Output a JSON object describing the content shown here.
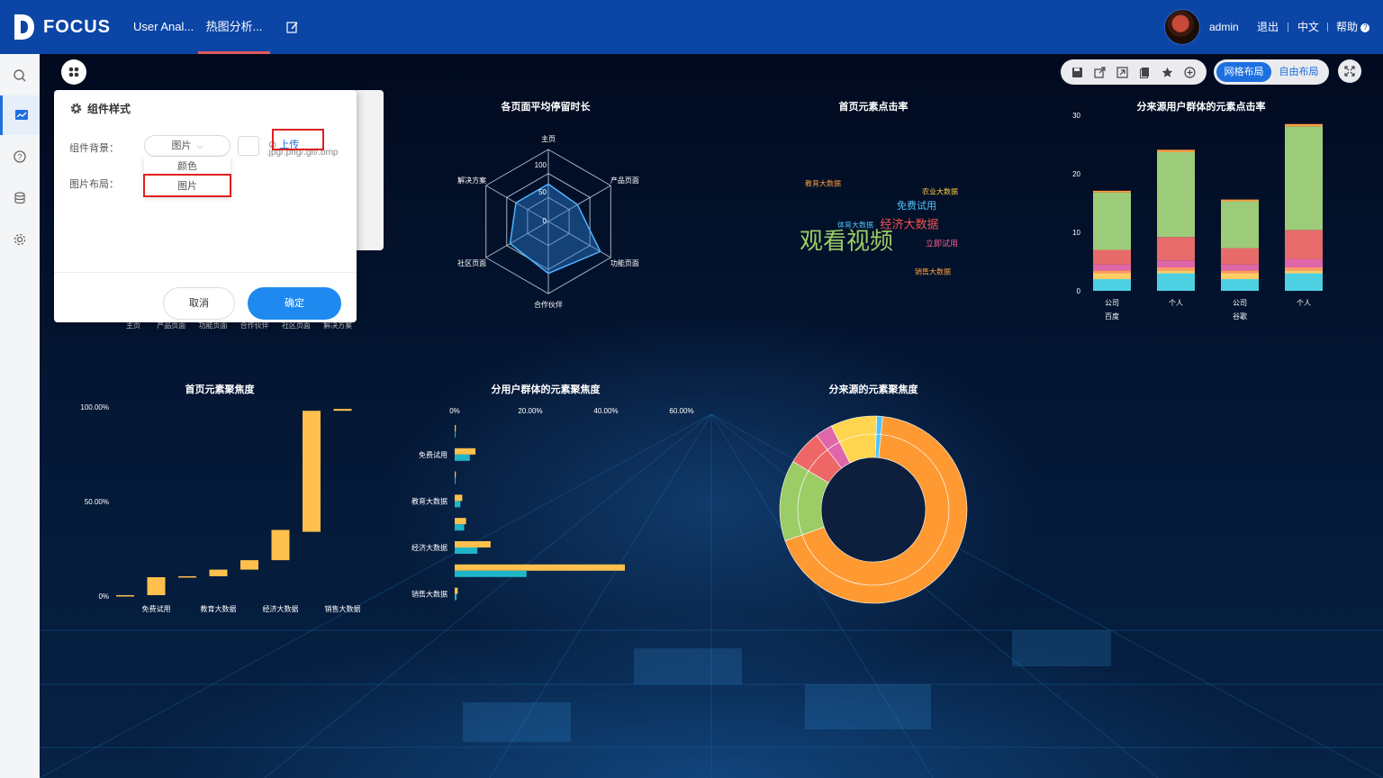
{
  "topbar": {
    "logo_text": "FOCUS",
    "tabs": [
      {
        "label": "User Anal...",
        "active": false
      },
      {
        "label": "热图分析...",
        "active": true
      }
    ],
    "user": "admin",
    "logout": "退出",
    "language": "中文",
    "help": "帮助"
  },
  "sidebar": {
    "items": [
      "search-icon",
      "dashboard-icon",
      "help-icon",
      "database-icon",
      "settings-icon"
    ],
    "active_index": 1
  },
  "toolbar": {
    "icons": [
      "save-icon",
      "export-icon",
      "share-icon",
      "copy-icon",
      "star-icon",
      "add-icon"
    ],
    "grid_layout": "网格布局",
    "free_layout": "自由布局"
  },
  "dialog": {
    "title": "组件样式",
    "background_label": "组件背景：",
    "background_value": "图片",
    "layout_label": "图片布局：",
    "options": [
      "颜色",
      "图片"
    ],
    "upload": "上传",
    "upload_hint": ".jpg/.png/.gif/.bmp",
    "cancel": "取消",
    "confirm": "确定"
  },
  "chart_data": [
    {
      "type": "radar",
      "title": "各页面平均停留时长",
      "indicators": [
        "主页",
        "产品页面",
        "功能页面",
        "合作伙伴",
        "社区页面",
        "解决方案"
      ],
      "ticks": [
        "100",
        "50",
        "0"
      ],
      "max": 150,
      "values": [
        78,
        70,
        125,
        108,
        92,
        78
      ]
    },
    {
      "type": "wordcloud",
      "title": "首页元素点击率",
      "words": [
        {
          "text": "观看视频",
          "size": 26,
          "color": "#9ccc65"
        },
        {
          "text": "经济大数据",
          "size": 13,
          "color": "#ef5350"
        },
        {
          "text": "免费试用",
          "size": 11,
          "color": "#4fc3f7"
        },
        {
          "text": "立即试用",
          "size": 9,
          "color": "#f06292"
        },
        {
          "text": "教育大数据",
          "size": 8,
          "color": "#ff9f43"
        },
        {
          "text": "农业大数据",
          "size": 8,
          "color": "#ffcc40"
        },
        {
          "text": "体育大数据",
          "size": 8,
          "color": "#4fc3f7"
        },
        {
          "text": "销售大数据",
          "size": 8,
          "color": "#ff9f43"
        }
      ]
    },
    {
      "type": "bar",
      "stacked": true,
      "title": "分来源用户群体的元素点击率",
      "categories": [
        "公司",
        "个人",
        "公司",
        "个人"
      ],
      "groups": [
        "百度",
        "谷歌"
      ],
      "ylim": [
        0,
        30
      ],
      "yticks": [
        "0",
        "10",
        "20",
        "30"
      ],
      "series": [
        {
          "color": "#4dd0e1",
          "values": [
            2,
            3,
            2,
            3
          ]
        },
        {
          "color": "#ffcc66",
          "values": [
            1,
            0.5,
            1,
            0.5
          ]
        },
        {
          "color": "#ff9966",
          "values": [
            0.5,
            0.5,
            0.5,
            0.5
          ]
        },
        {
          "color": "#e066aa",
          "values": [
            1,
            1.2,
            1,
            1.4
          ]
        },
        {
          "color": "#e86b6b",
          "values": [
            2.5,
            4,
            2.8,
            5
          ]
        },
        {
          "color": "#9ccc7a",
          "values": [
            9.8,
            14.5,
            8,
            17.7
          ]
        },
        {
          "color": "#ff9f43",
          "values": [
            0.3,
            0.4,
            0.3,
            0.4
          ]
        }
      ]
    },
    {
      "type": "bar",
      "subtype": "waterfall",
      "title": "首页元素聚焦度",
      "ylim": [
        0,
        100
      ],
      "yticks": [
        "0%",
        "50.00%",
        "100.00%"
      ],
      "xlabels": [
        "免费试用",
        "教育大数据",
        "经济大数据",
        "销售大数据"
      ],
      "color": "#ffc04d",
      "steps": [
        [
          0,
          0.5
        ],
        [
          0.5,
          10
        ],
        [
          10,
          10.5
        ],
        [
          10.5,
          14
        ],
        [
          14,
          19
        ],
        [
          19,
          35
        ],
        [
          34,
          98
        ],
        [
          98,
          99
        ]
      ]
    },
    {
      "type": "bar",
      "orientation": "horizontal",
      "title": "分用户群体的元素聚焦度",
      "xticks": [
        "0%",
        "20.00%",
        "40.00%",
        "60.00%"
      ],
      "xlim": [
        0,
        60
      ],
      "category_labels": [
        "免费试用",
        "教育大数据",
        "经济大数据",
        "销售大数据"
      ],
      "rows": [
        {
          "a": 0.3,
          "b": 0.2
        },
        {
          "a": 5.5,
          "b": 4
        },
        {
          "a": 0.3,
          "b": 0.2
        },
        {
          "a": 2,
          "b": 1.5
        },
        {
          "a": 3,
          "b": 2.5
        },
        {
          "a": 9.5,
          "b": 6
        },
        {
          "a": 45,
          "b": 19
        },
        {
          "a": 0.8,
          "b": 0.5
        }
      ],
      "series_colors": [
        "#ffc04d",
        "#1fb5c8"
      ]
    },
    {
      "type": "pie",
      "subtype": "sunburst",
      "title": "分来源的元素聚焦度",
      "inner": [
        {
          "value": 68,
          "color": "#ff9a33"
        },
        {
          "value": 14,
          "color": "#9ccc65"
        },
        {
          "value": 6,
          "color": "#ee6666"
        },
        {
          "value": 3,
          "color": "#e066aa"
        },
        {
          "value": 8,
          "color": "#ffd54f"
        },
        {
          "value": 1,
          "color": "#4fc3f7"
        }
      ]
    }
  ]
}
